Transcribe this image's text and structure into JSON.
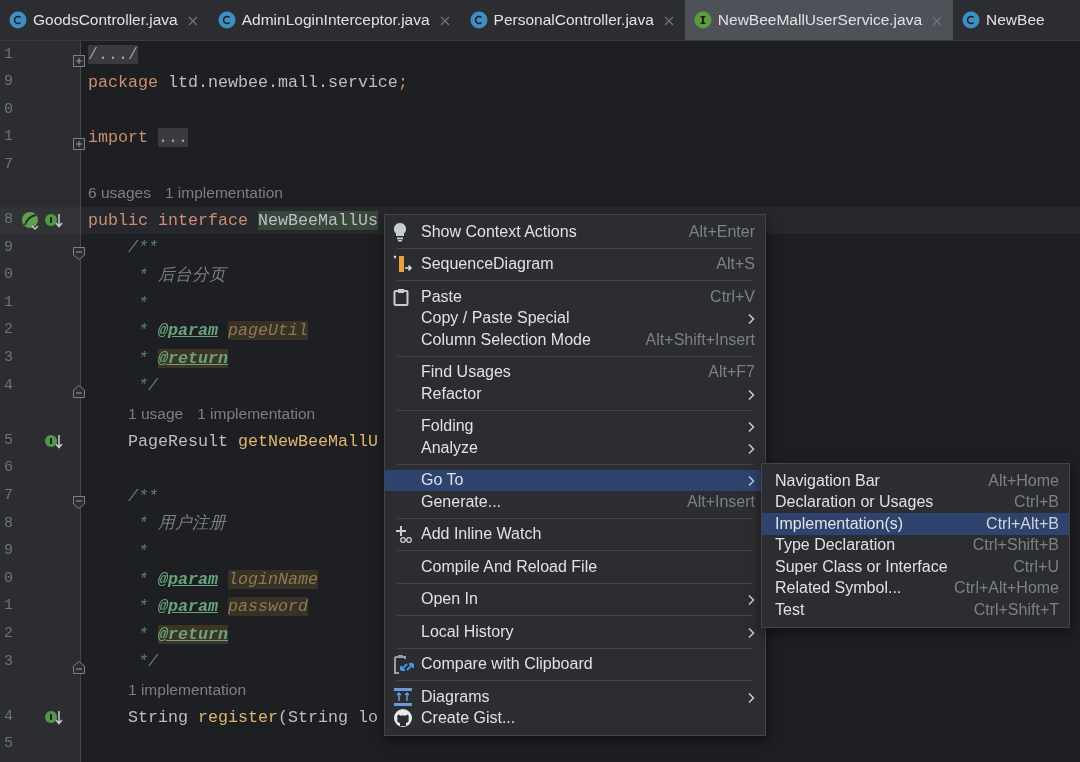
{
  "tabs": [
    {
      "label": "GoodsController.java",
      "kind": "class",
      "selected": false,
      "closable": true
    },
    {
      "label": "AdminLoginInterceptor.java",
      "kind": "class",
      "selected": false,
      "closable": true
    },
    {
      "label": "PersonalController.java",
      "kind": "class",
      "selected": false,
      "closable": true
    },
    {
      "label": "NewBeeMallUserService.java",
      "kind": "interface",
      "selected": true,
      "closable": true
    },
    {
      "label": "NewBee",
      "kind": "class",
      "selected": false,
      "closable": false
    }
  ],
  "editor": {
    "lines": [
      {
        "kind": "code",
        "number": "1",
        "indented": false,
        "fold_marker": {
          "kind": "collapsed"
        },
        "code": [
          {
            "kind": "folded",
            "text": "/.../"
          }
        ]
      },
      {
        "kind": "code",
        "number": "9",
        "indented": false,
        "code": [
          {
            "kind": "kw",
            "text": "package "
          },
          {
            "kind": "plain",
            "text": "ltd.newbee.mall.service"
          },
          {
            "kind": "kw",
            "text": ";"
          }
        ]
      },
      {
        "kind": "code",
        "number": "0",
        "indented": false
      },
      {
        "kind": "code",
        "number": "1",
        "indented": false,
        "fold_marker": {
          "kind": "collapsed"
        },
        "code": [
          {
            "kind": "kw",
            "text": "import "
          },
          {
            "kind": "folded",
            "text": "..."
          }
        ]
      },
      {
        "kind": "code",
        "number": "7",
        "indented": false
      },
      {
        "kind": "hint",
        "indented": false,
        "parts": [
          "6 usages",
          "1 implementation"
        ]
      },
      {
        "kind": "code",
        "number": "8",
        "indented": false,
        "current": true,
        "gutter_icons": [
          {
            "kind": "leaf"
          },
          {
            "kind": "implemented"
          }
        ],
        "code": [
          {
            "kind": "kw",
            "text": "public "
          },
          {
            "kind": "kw",
            "text": "interface "
          },
          {
            "kind": "ident",
            "text": "NewBeeMallUs"
          }
        ]
      },
      {
        "kind": "code",
        "number": "9",
        "indented": true,
        "fold_marker": {
          "kind": "start"
        },
        "code": [
          {
            "kind": "doc",
            "text": "/**"
          }
        ]
      },
      {
        "kind": "code",
        "number": "0",
        "indented": true,
        "code": [
          {
            "kind": "doc",
            "text": " * "
          },
          {
            "kind": "doccn",
            "text": "后台分页"
          }
        ]
      },
      {
        "kind": "code",
        "number": "1",
        "indented": true,
        "code": [
          {
            "kind": "doc",
            "text": " *"
          }
        ]
      },
      {
        "kind": "code",
        "number": "2",
        "indented": true,
        "code": [
          {
            "kind": "doc",
            "text": " * "
          },
          {
            "kind": "tag",
            "text": "@param"
          },
          {
            "kind": "param",
            "text": "pageUtil"
          }
        ]
      },
      {
        "kind": "code",
        "number": "3",
        "indented": true,
        "code": [
          {
            "kind": "doc",
            "text": " * "
          },
          {
            "kind": "taghl",
            "text": "@return"
          }
        ]
      },
      {
        "kind": "code",
        "number": "4",
        "indented": true,
        "fold_marker": {
          "kind": "end"
        },
        "code": [
          {
            "kind": "doc",
            "text": " */"
          }
        ]
      },
      {
        "kind": "hint",
        "indented": true,
        "parts": [
          "1 usage",
          "1 implementation"
        ]
      },
      {
        "kind": "code",
        "number": "5",
        "indented": true,
        "gutter_icons": [
          {
            "kind": "implemented"
          }
        ],
        "code": [
          {
            "kind": "plain",
            "text": "PageResult "
          },
          {
            "kind": "method",
            "text": "getNewBeeMallU"
          }
        ]
      },
      {
        "kind": "code",
        "number": "6",
        "indented": false
      },
      {
        "kind": "code",
        "number": "7",
        "indented": true,
        "fold_marker": {
          "kind": "start"
        },
        "code": [
          {
            "kind": "doc",
            "text": "/**"
          }
        ]
      },
      {
        "kind": "code",
        "number": "8",
        "indented": true,
        "code": [
          {
            "kind": "doc",
            "text": " * "
          },
          {
            "kind": "doccn",
            "text": "用户注册"
          }
        ]
      },
      {
        "kind": "code",
        "number": "9",
        "indented": true,
        "code": [
          {
            "kind": "doc",
            "text": " *"
          }
        ]
      },
      {
        "kind": "code",
        "number": "0",
        "indented": true,
        "code": [
          {
            "kind": "doc",
            "text": " * "
          },
          {
            "kind": "tag",
            "text": "@param"
          },
          {
            "kind": "param",
            "text": "loginName"
          }
        ]
      },
      {
        "kind": "code",
        "number": "1",
        "indented": true,
        "code": [
          {
            "kind": "doc",
            "text": " * "
          },
          {
            "kind": "tag",
            "text": "@param"
          },
          {
            "kind": "param",
            "text": "password"
          }
        ]
      },
      {
        "kind": "code",
        "number": "2",
        "indented": true,
        "code": [
          {
            "kind": "doc",
            "text": " * "
          },
          {
            "kind": "taghl",
            "text": "@return"
          }
        ]
      },
      {
        "kind": "code",
        "number": "3",
        "indented": true,
        "fold_marker": {
          "kind": "end"
        },
        "code": [
          {
            "kind": "doc",
            "text": " */"
          }
        ]
      },
      {
        "kind": "hint",
        "indented": true,
        "parts": [
          "1 implementation"
        ]
      },
      {
        "kind": "code",
        "number": "4",
        "indented": true,
        "gutter_icons": [
          {
            "kind": "implemented"
          }
        ],
        "code": [
          {
            "kind": "plain",
            "text": "String "
          },
          {
            "kind": "method",
            "text": "register"
          },
          {
            "kind": "plain",
            "text": "(String lo"
          }
        ]
      },
      {
        "kind": "code",
        "number": "5",
        "indented": false
      }
    ]
  },
  "context_menu": {
    "items": [
      {
        "label": "Show Context Actions",
        "shortcut": "Alt+Enter",
        "selected": false
      },
      {
        "label": "SequenceDiagram",
        "shortcut": "Alt+S",
        "separated": true,
        "selected": false
      },
      {
        "label": "Paste",
        "shortcut": "Ctrl+V",
        "separated": true,
        "selected": false
      },
      {
        "label": "Copy / Paste Special",
        "submenu": true,
        "selected": false
      },
      {
        "label": "Column Selection Mode",
        "shortcut": "Alt+Shift+Insert",
        "selected": false
      },
      {
        "label": "Find Usages",
        "shortcut": "Alt+F7",
        "separated": true,
        "selected": false
      },
      {
        "label": "Refactor",
        "submenu": true,
        "selected": false
      },
      {
        "label": "Folding",
        "submenu": true,
        "separated": true,
        "selected": false
      },
      {
        "label": "Analyze",
        "submenu": true,
        "selected": false
      },
      {
        "label": "Go To",
        "submenu": true,
        "separated": true,
        "selected": true
      },
      {
        "label": "Generate...",
        "shortcut": "Alt+Insert",
        "selected": false
      },
      {
        "label": "Add Inline Watch",
        "separated": true,
        "selected": false
      },
      {
        "label": "Compile And Reload File",
        "separated": true,
        "selected": false
      },
      {
        "label": "Open In",
        "submenu": true,
        "separated": true,
        "selected": false
      },
      {
        "label": "Local History",
        "submenu": true,
        "separated": true,
        "selected": false
      },
      {
        "label": "Compare with Clipboard",
        "separated": true,
        "selected": false
      },
      {
        "label": "Diagrams",
        "submenu": true,
        "separated": true,
        "selected": false
      },
      {
        "label": "Create Gist...",
        "selected": false
      }
    ]
  },
  "submenu": {
    "items": [
      {
        "label": "Navigation Bar",
        "shortcut": "Alt+Home",
        "selected": false
      },
      {
        "label": "Declaration or Usages",
        "shortcut": "Ctrl+B",
        "selected": false
      },
      {
        "label": "Implementation(s)",
        "shortcut": "Ctrl+Alt+B",
        "selected": true
      },
      {
        "label": "Type Declaration",
        "shortcut": "Ctrl+Shift+B",
        "selected": false
      },
      {
        "label": "Super Class or Interface",
        "shortcut": "Ctrl+U",
        "selected": false
      },
      {
        "label": "Related Symbol...",
        "shortcut": "Ctrl+Alt+Home",
        "selected": false
      },
      {
        "label": "Test",
        "shortcut": "Ctrl+Shift+T",
        "selected": false
      }
    ]
  }
}
